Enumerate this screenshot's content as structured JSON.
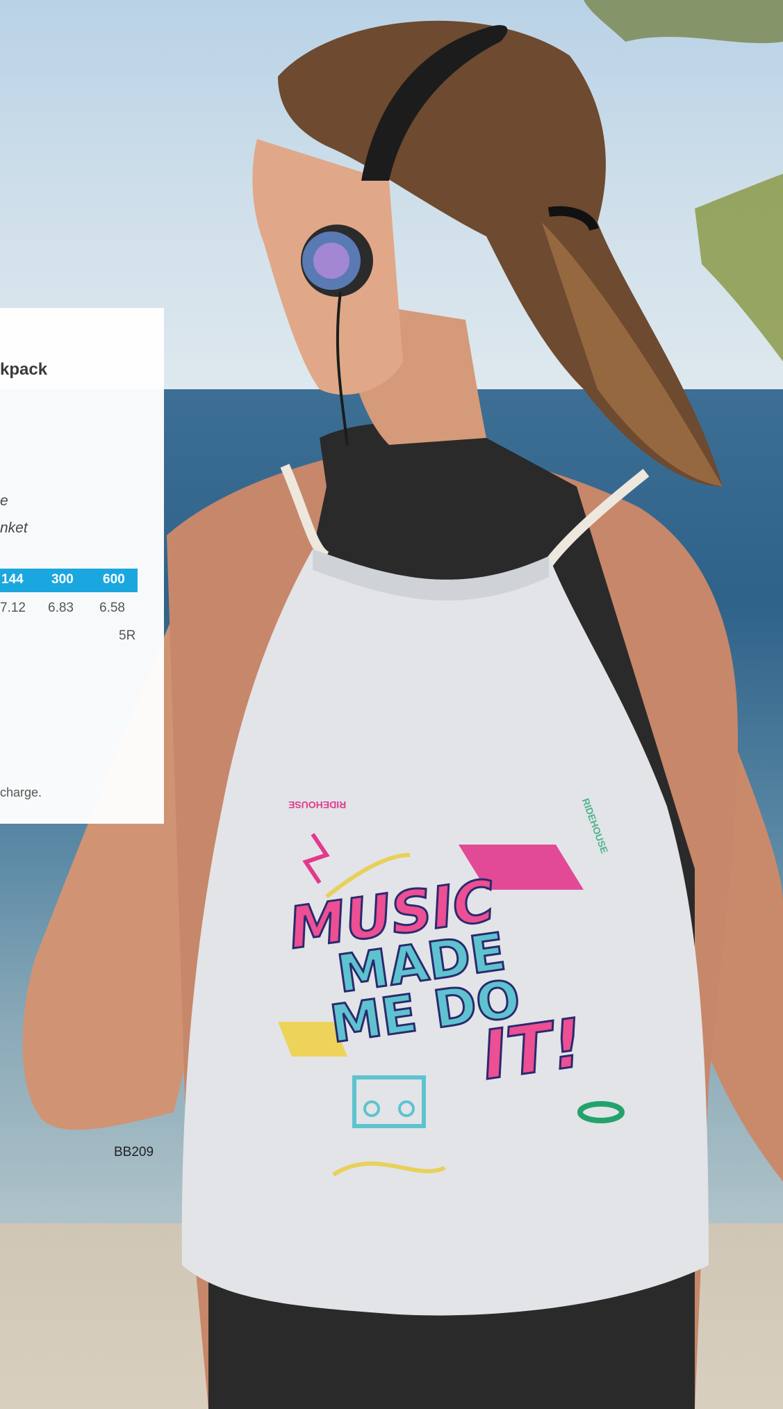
{
  "panel": {
    "title_fragment": "kpack",
    "description_line1": "e",
    "description_line2": "nket",
    "quantities": [
      "144",
      "300",
      "600"
    ],
    "prices": [
      "7.12",
      "6.83",
      "6.58"
    ],
    "setup_code": "5R",
    "footnote": "charge."
  },
  "product_code": "BB209",
  "bag_print": {
    "line1": "MUSIC",
    "line2": "MADE",
    "line3": "ME DO",
    "line4": "IT!",
    "small_brand": "RIDEHOUSE"
  },
  "colors": {
    "accent": "#1aa7e0",
    "panel_bg": "#ffffff",
    "text_dark": "#3a3a3a"
  }
}
